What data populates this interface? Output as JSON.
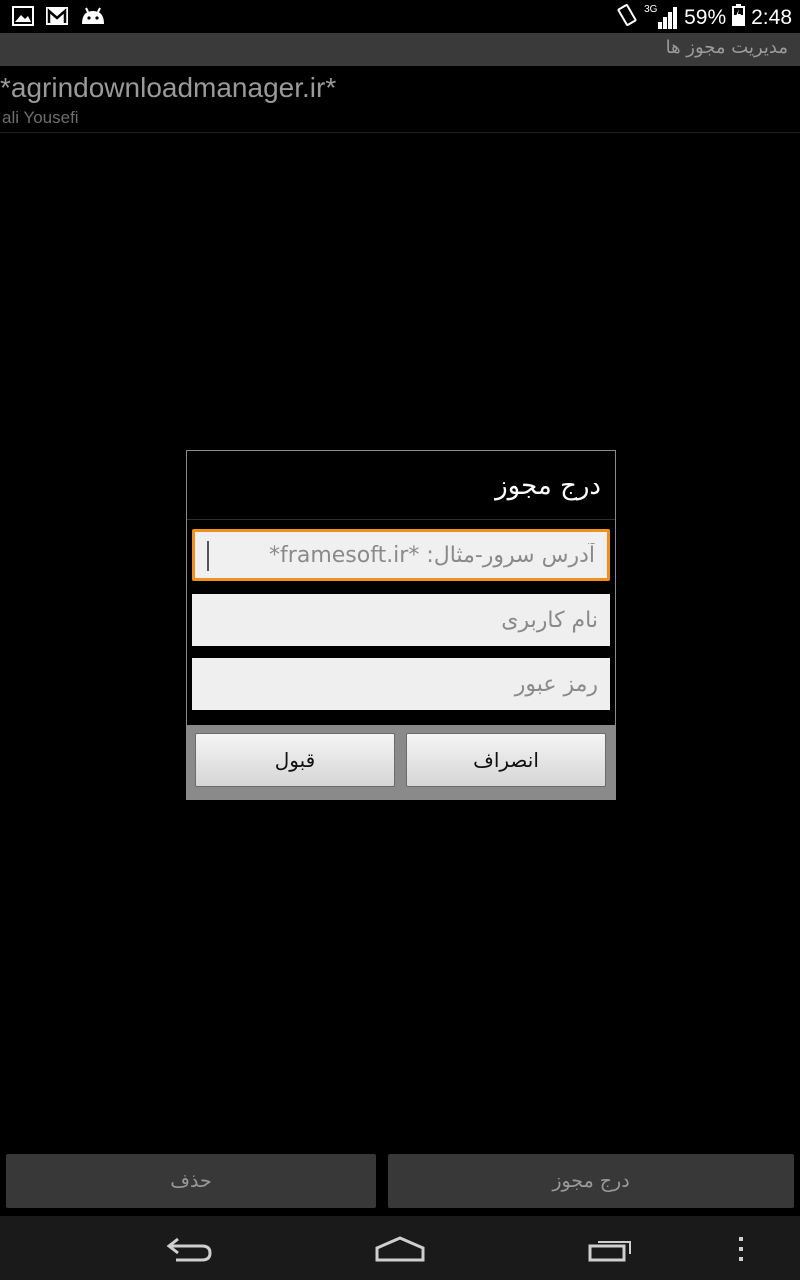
{
  "statusbar": {
    "icons_left": [
      "gallery-icon",
      "gmail-icon",
      "android-icon"
    ],
    "icons_right": [
      "vibrate-icon",
      "signal-3g-icon",
      "battery-charging-icon"
    ],
    "network": "3G",
    "battery": "59%",
    "time": "2:48"
  },
  "app": {
    "title": "مدیریت مجوز ها"
  },
  "list": {
    "items": [
      {
        "title": "*agrindownloadmanager.ir*",
        "subtitle": "ali Yousefi"
      }
    ]
  },
  "dialog": {
    "title": "درج مجوز",
    "fields": {
      "server": {
        "placeholder": "آدرس سرور-مثال: *framesoft.ir*",
        "value": ""
      },
      "username": {
        "placeholder": "نام کاربری",
        "value": ""
      },
      "password": {
        "placeholder": "رمز عبور",
        "value": ""
      }
    },
    "buttons": {
      "cancel": "انصراف",
      "accept": "قبول"
    }
  },
  "bottom_actions": {
    "add": "درج مجوز",
    "delete": "حذف"
  },
  "navbar": {
    "icons": [
      "back-icon",
      "home-icon",
      "recent-apps-icon",
      "menu-icon"
    ]
  }
}
